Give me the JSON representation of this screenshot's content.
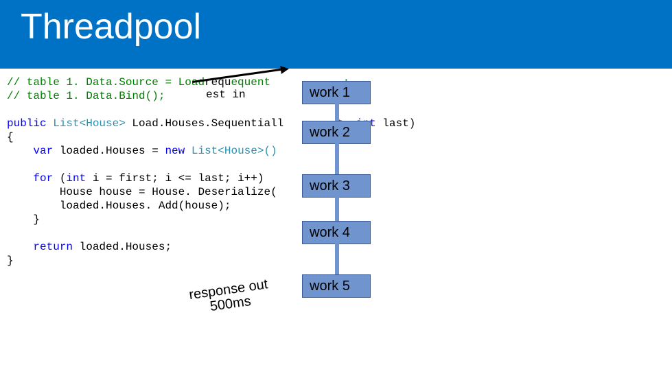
{
  "title": "Threadpool",
  "code": {
    "l1": "// table 1. Data.Source = Load",
    "l1b": "requ",
    "l1c": "equent           ;",
    "l1d": "est in",
    "l2": "// table 1. Data.Bind();",
    "l3": "public",
    "l3b": " List<House>",
    "l3c": " Load.Houses.Sequentiall        t, ",
    "l3d": "int",
    "l3e": " last)",
    "l4": "{",
    "l5a": "    ",
    "l5b": "var",
    "l5c": " loaded.Houses = ",
    "l5d": "new",
    "l5e": " List<House>()",
    "l6a": "    ",
    "l6b": "for",
    "l6c": " (",
    "l6d": "int",
    "l6e": " i = first; i <= last; i++)",
    "l7": "        House house = House. Deserialize(",
    "l8": "        loaded.Houses. Add(house);",
    "l9": "    }",
    "l10a": "    ",
    "l10b": "return",
    "l10c": " loaded.Houses;",
    "l11": "}"
  },
  "workboxes": [
    "work 1",
    "work 2",
    "work 3",
    "work 4",
    "work 5"
  ],
  "labels": {
    "request_in": "request in",
    "response_out_line1": "response out",
    "response_out_line2": "500ms"
  }
}
